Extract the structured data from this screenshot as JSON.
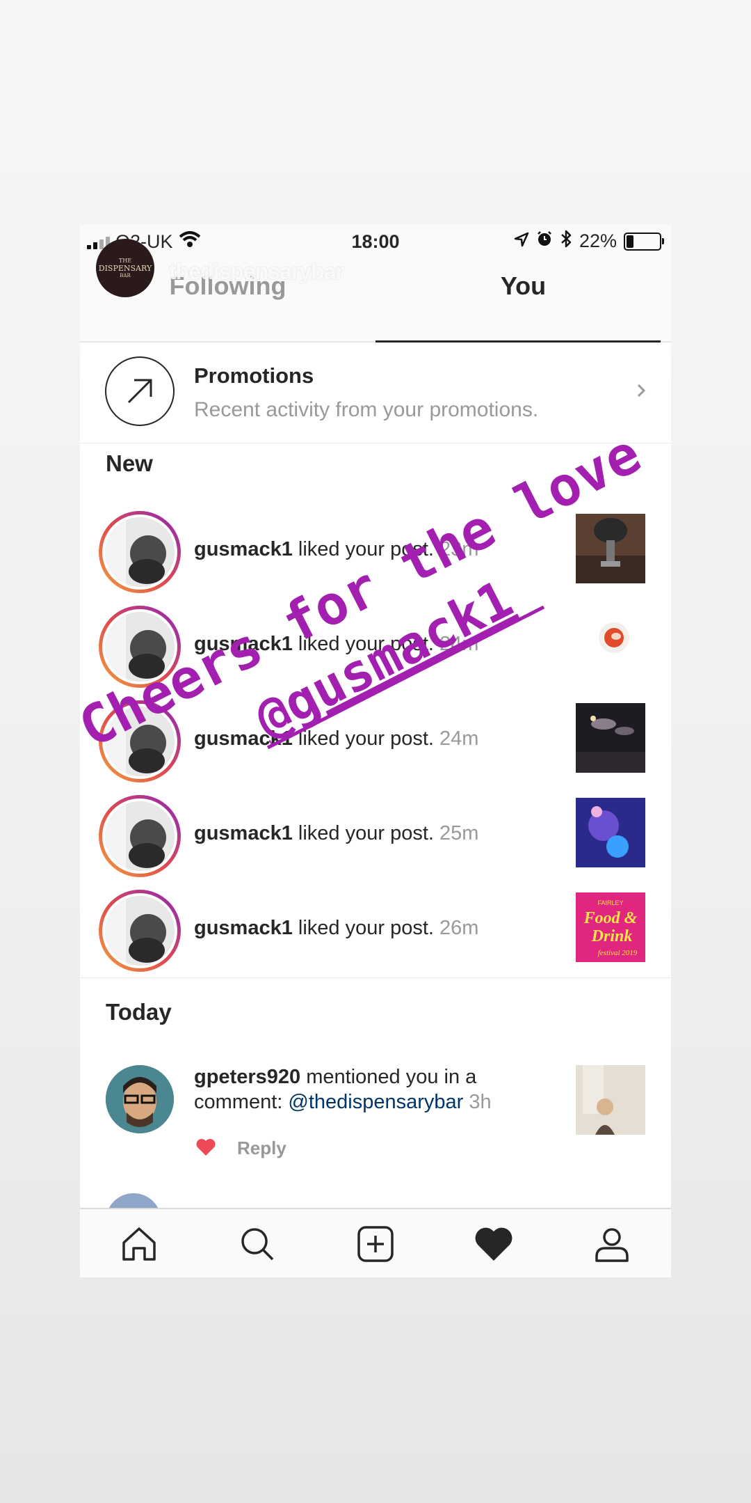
{
  "status_bar": {
    "carrier": "O2-UK",
    "time": "18:00",
    "battery": "22%",
    "battery_level": 0.22
  },
  "story_overlay": {
    "username": "thedispensarybar",
    "logo_lines": [
      "THE",
      "DISPENSARY",
      "BAR"
    ]
  },
  "tabs": [
    {
      "label": "Following",
      "active": false
    },
    {
      "label": "You",
      "active": true
    }
  ],
  "promotions": {
    "title": "Promotions",
    "subtitle": "Recent activity from your promotions."
  },
  "sections": {
    "new": "New",
    "today": "Today"
  },
  "new_activity": [
    {
      "username": "gusmack1",
      "action": " liked your post. ",
      "time": "23m"
    },
    {
      "username": "gusmack1",
      "action": " liked your post. ",
      "time": "24m"
    },
    {
      "username": "gusmack1",
      "action": " liked your post. ",
      "time": "24m"
    },
    {
      "username": "gusmack1",
      "action": " liked your post. ",
      "time": "25m"
    },
    {
      "username": "gusmack1",
      "action": " liked your post. ",
      "time": "26m"
    }
  ],
  "today_activity": {
    "username": "gpeters920",
    "action": " mentioned you in a comment: ",
    "mention": "@thedispensarybar",
    "time": "3h",
    "reply_label": "Reply"
  },
  "thumb5_text": {
    "line1": "FAIRLEY",
    "line2": "Food &",
    "line3": "Drink",
    "line4": "festival 2019"
  },
  "sticker": {
    "line1": "Cheers for the love",
    "line2": "@gusmack1",
    "color": "#a21fb0"
  },
  "bottom_nav": [
    "home-icon",
    "search-icon",
    "new-post-icon",
    "activity-heart-icon",
    "profile-icon"
  ]
}
